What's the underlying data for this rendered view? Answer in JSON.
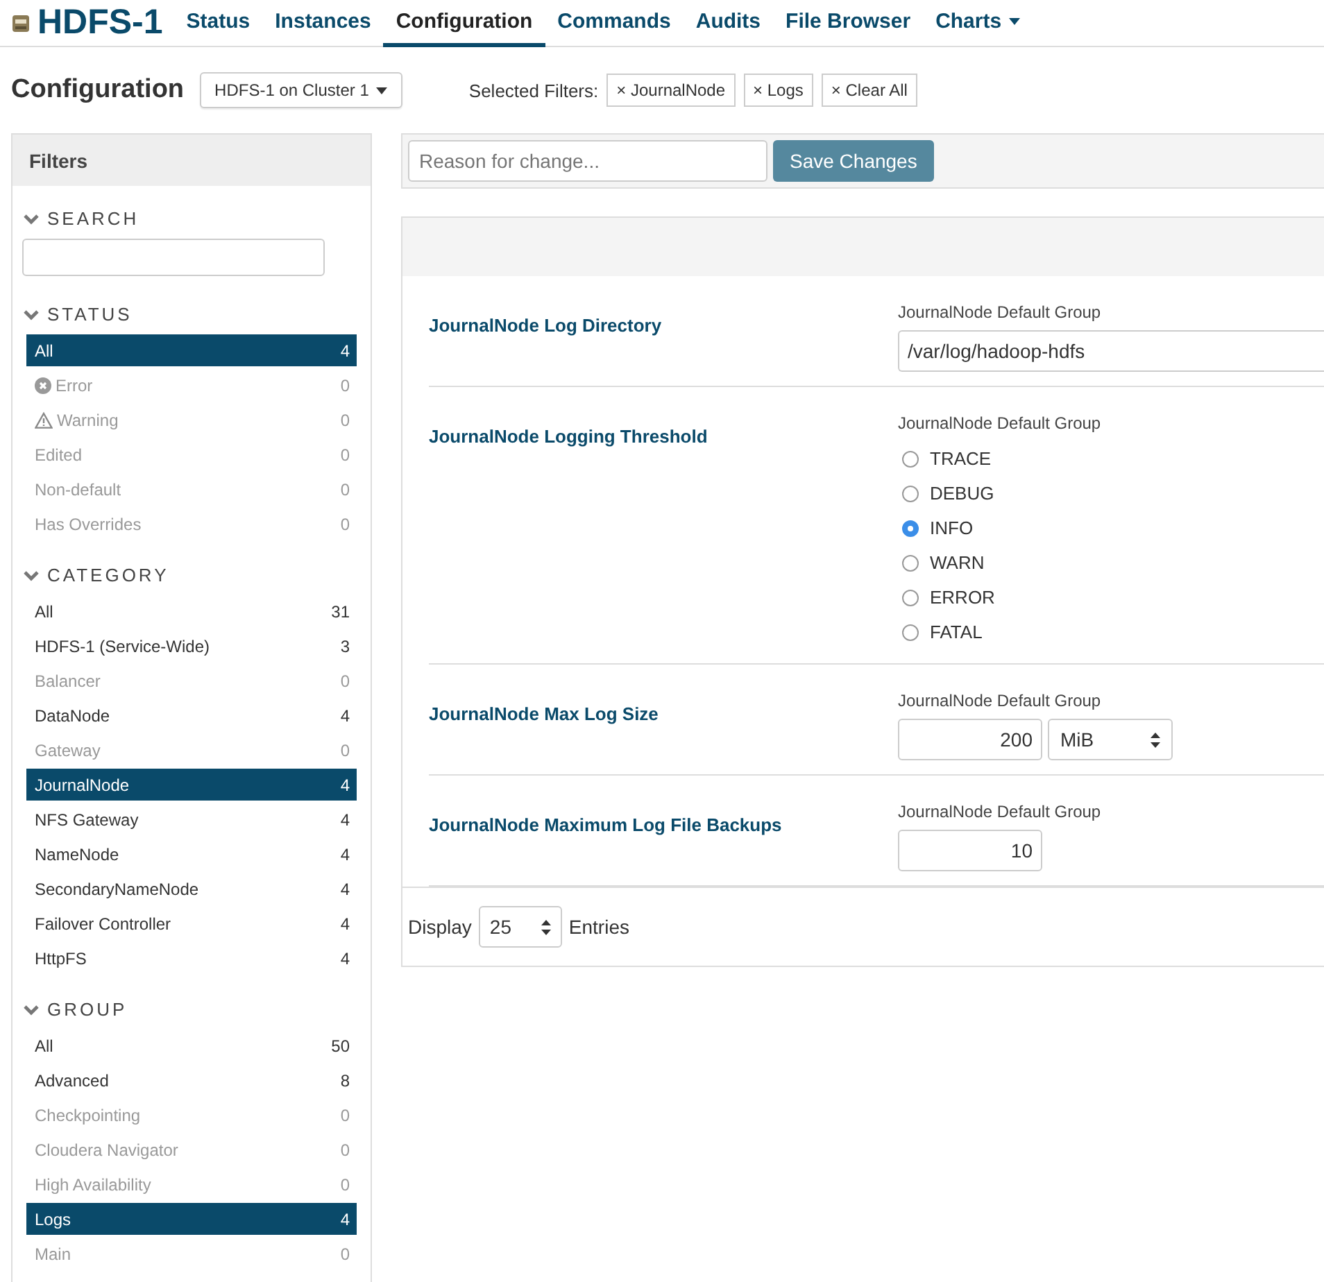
{
  "nav": {
    "title": "HDFS-1",
    "tabs": [
      {
        "label": "Status",
        "selected": false,
        "kind": "link"
      },
      {
        "label": "Instances",
        "selected": false,
        "kind": "link"
      },
      {
        "label": "Configuration",
        "selected": true,
        "kind": "link"
      },
      {
        "label": "Commands",
        "selected": false,
        "kind": "link"
      },
      {
        "label": "Audits",
        "selected": false,
        "kind": "link"
      },
      {
        "label": "File Browser",
        "selected": false,
        "kind": "link"
      },
      {
        "label": "Charts",
        "selected": false,
        "kind": "menu"
      }
    ]
  },
  "header": {
    "title": "Configuration",
    "scope": "HDFS-1 on Cluster 1",
    "filters_label": "Selected Filters:",
    "filters": [
      {
        "remove": "×",
        "label": "JournalNode"
      },
      {
        "remove": "×",
        "label": "Logs"
      },
      {
        "remove": "×",
        "label": "Clear All"
      }
    ]
  },
  "sidebar": {
    "title": "Filters",
    "sections": [
      {
        "title": "SEARCH",
        "kind": "search"
      },
      {
        "title": "STATUS",
        "kind": "list",
        "items": [
          {
            "label": "All",
            "count": "4",
            "selected": true,
            "disabled": false,
            "kind": "plain"
          },
          {
            "label": "Error",
            "count": "0",
            "selected": false,
            "disabled": true,
            "kind": "error"
          },
          {
            "label": "Warning",
            "count": "0",
            "selected": false,
            "disabled": true,
            "kind": "warning"
          },
          {
            "label": "Edited",
            "count": "0",
            "selected": false,
            "disabled": true,
            "kind": "plain"
          },
          {
            "label": "Non-default",
            "count": "0",
            "selected": false,
            "disabled": true,
            "kind": "plain"
          },
          {
            "label": "Has Overrides",
            "count": "0",
            "selected": false,
            "disabled": true,
            "kind": "plain"
          }
        ]
      },
      {
        "title": "CATEGORY",
        "kind": "list",
        "items": [
          {
            "label": "All",
            "count": "31",
            "selected": false,
            "disabled": false,
            "kind": "plain"
          },
          {
            "label": "HDFS-1 (Service-Wide)",
            "count": "3",
            "selected": false,
            "disabled": false,
            "kind": "plain"
          },
          {
            "label": "Balancer",
            "count": "0",
            "selected": false,
            "disabled": true,
            "kind": "plain"
          },
          {
            "label": "DataNode",
            "count": "4",
            "selected": false,
            "disabled": false,
            "kind": "plain"
          },
          {
            "label": "Gateway",
            "count": "0",
            "selected": false,
            "disabled": true,
            "kind": "plain"
          },
          {
            "label": "JournalNode",
            "count": "4",
            "selected": true,
            "disabled": false,
            "kind": "plain"
          },
          {
            "label": "NFS Gateway",
            "count": "4",
            "selected": false,
            "disabled": false,
            "kind": "plain"
          },
          {
            "label": "NameNode",
            "count": "4",
            "selected": false,
            "disabled": false,
            "kind": "plain"
          },
          {
            "label": "SecondaryNameNode",
            "count": "4",
            "selected": false,
            "disabled": false,
            "kind": "plain"
          },
          {
            "label": "Failover Controller",
            "count": "4",
            "selected": false,
            "disabled": false,
            "kind": "plain"
          },
          {
            "label": "HttpFS",
            "count": "4",
            "selected": false,
            "disabled": false,
            "kind": "plain"
          }
        ]
      },
      {
        "title": "GROUP",
        "kind": "list",
        "items": [
          {
            "label": "All",
            "count": "50",
            "selected": false,
            "disabled": false,
            "kind": "plain"
          },
          {
            "label": "Advanced",
            "count": "8",
            "selected": false,
            "disabled": false,
            "kind": "plain"
          },
          {
            "label": "Checkpointing",
            "count": "0",
            "selected": false,
            "disabled": true,
            "kind": "plain"
          },
          {
            "label": "Cloudera Navigator",
            "count": "0",
            "selected": false,
            "disabled": true,
            "kind": "plain"
          },
          {
            "label": "High Availability",
            "count": "0",
            "selected": false,
            "disabled": true,
            "kind": "plain"
          },
          {
            "label": "Logs",
            "count": "4",
            "selected": true,
            "disabled": false,
            "kind": "plain"
          },
          {
            "label": "Main",
            "count": "0",
            "selected": false,
            "disabled": true,
            "kind": "plain"
          }
        ]
      }
    ]
  },
  "toolbar": {
    "reason_placeholder": "Reason for change...",
    "save_label": "Save Changes"
  },
  "settings": [
    {
      "title": "JournalNode Log Directory",
      "group": "JournalNode Default Group",
      "kind": "text",
      "value": "/var/log/hadoop-hdfs"
    },
    {
      "title": "JournalNode Logging Threshold",
      "group": "JournalNode Default Group",
      "kind": "radio",
      "options": [
        {
          "label": "TRACE",
          "selected": false
        },
        {
          "label": "DEBUG",
          "selected": false
        },
        {
          "label": "INFO",
          "selected": true
        },
        {
          "label": "WARN",
          "selected": false
        },
        {
          "label": "ERROR",
          "selected": false
        },
        {
          "label": "FATAL",
          "selected": false
        }
      ]
    },
    {
      "title": "JournalNode Max Log Size",
      "group": "JournalNode Default Group",
      "kind": "size",
      "value": "200",
      "unit": "MiB"
    },
    {
      "title": "JournalNode Maximum Log File Backups",
      "group": "JournalNode Default Group",
      "kind": "number",
      "value": "10"
    }
  ],
  "pager": {
    "before": "Display",
    "value": "25",
    "after": "Entries"
  }
}
